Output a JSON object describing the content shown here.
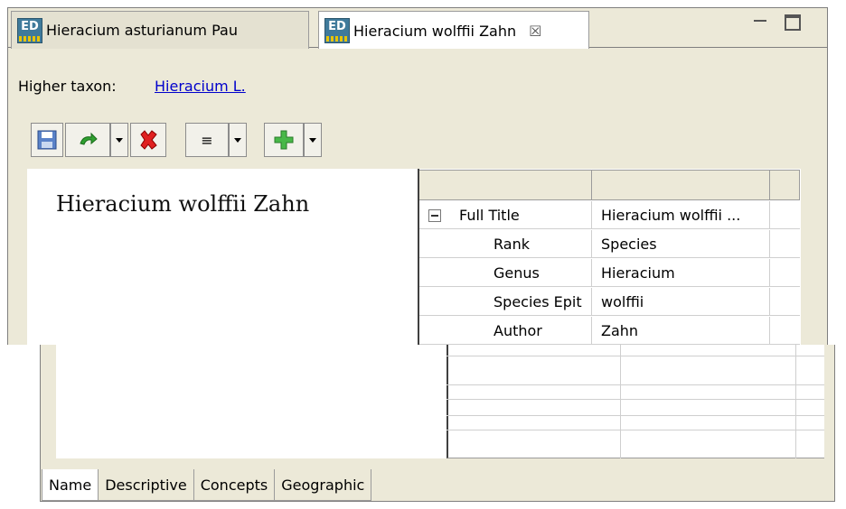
{
  "tabs": [
    {
      "label": "Hieracium asturianum Pau",
      "icon": "ed-icon"
    },
    {
      "label": "Hieracium wolffii Zahn",
      "icon": "ed-icon",
      "close": "☒"
    }
  ],
  "icon_text": "ED",
  "higher_taxon": {
    "label": "Higher taxon:",
    "link": "Hieracium L."
  },
  "toolbar": {
    "list_glyph": "≡"
  },
  "name_display": "Hieracium wolffii Zahn",
  "grid": {
    "rows": [
      {
        "key": "Full Title",
        "value": "Hieracium wolffii ..."
      },
      {
        "key": "Rank",
        "value": "Species"
      },
      {
        "key": "Genus",
        "value": "Hieracium"
      },
      {
        "key": "Species Epit",
        "value": "wolffii"
      },
      {
        "key": "Author",
        "value": "Zahn"
      }
    ]
  },
  "bottom_tabs": [
    "Name",
    "Descriptive",
    "Concepts",
    "Geographic"
  ],
  "colors": {
    "link": "#0000cc",
    "chrome": "#ece9d8",
    "delete": "#e02020",
    "add": "#48b848",
    "refresh": "#2fa02f"
  }
}
